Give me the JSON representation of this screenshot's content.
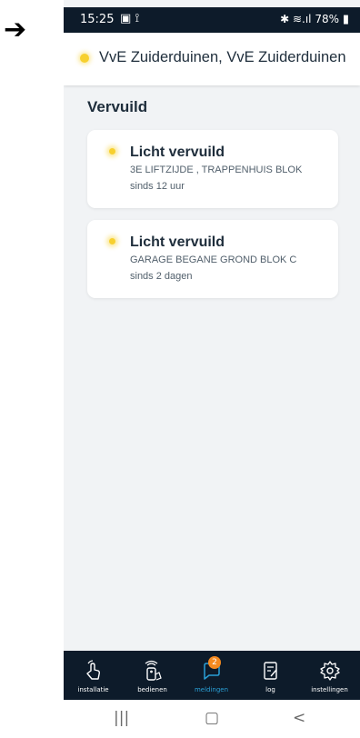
{
  "annotation_arrow": "➔",
  "status_bar": {
    "time": "15:25",
    "left_icons": "▣ ⟟",
    "right_icons": "✱ ≋.ıl",
    "battery": "78%"
  },
  "header": {
    "title": "VvE Zuiderduinen, VvE Zuiderduinen",
    "status_color": "#f7d02e"
  },
  "section": {
    "title": "Vervuild"
  },
  "notifications": [
    {
      "title": "Licht vervuild",
      "location": "3E LIFTZIJDE , TRAPPENHUIS BLOK",
      "time": "sinds 12 uur"
    },
    {
      "title": "Licht vervuild",
      "location": "GARAGE BEGANE GROND BLOK C",
      "time": "sinds 2 dagen"
    }
  ],
  "tabbar": {
    "tabs": [
      {
        "label": "installatie",
        "icon": "hand-point-icon"
      },
      {
        "label": "bedienen",
        "icon": "remote-control-icon"
      },
      {
        "label": "meldingen",
        "icon": "message-icon",
        "active": true,
        "badge": "2"
      },
      {
        "label": "log",
        "icon": "log-icon"
      },
      {
        "label": "instellingen",
        "icon": "gear-icon"
      }
    ],
    "active_color": "#2aa0d6",
    "badge_color": "#f58a1f"
  },
  "android_nav": {
    "recent": "|||",
    "home": "▢",
    "back": "<"
  }
}
